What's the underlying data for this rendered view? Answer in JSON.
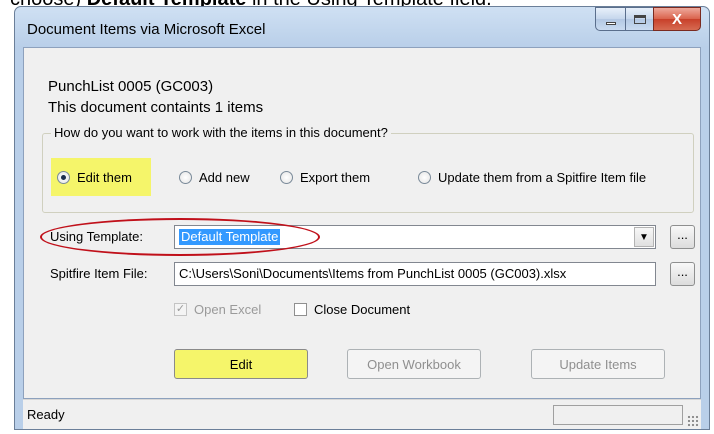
{
  "caption": {
    "prefix": "choose) ",
    "bold": "Default Template",
    "suffix": " in the Using Template field."
  },
  "window": {
    "title": "Document Items via Microsoft Excel",
    "close_glyph": "X"
  },
  "document": {
    "name": "PunchList 0005 (GC003)",
    "count_text": "This document containts 1 items"
  },
  "mode_group": {
    "legend": "How do you want to work with the items in this document?",
    "options": [
      {
        "label": "Edit them",
        "checked": true
      },
      {
        "label": "Add new",
        "checked": false
      },
      {
        "label": "Export them",
        "checked": false
      },
      {
        "label": "Update them from a Spitfire Item file",
        "checked": false
      }
    ]
  },
  "template": {
    "label": "Using Template:",
    "value": "Default Template",
    "browse_label": "..."
  },
  "item_file": {
    "label": "Spitfire Item File:",
    "value": "C:\\Users\\Soni\\Documents\\Items from PunchList 0005 (GC003).xlsx",
    "browse_label": "..."
  },
  "options": {
    "open_excel": {
      "label": "Open Excel",
      "checked": true,
      "enabled": false
    },
    "close_document": {
      "label": "Close Document",
      "checked": false,
      "enabled": true
    }
  },
  "buttons": {
    "edit": "Edit",
    "open_workbook": "Open Workbook",
    "update_items": "Update Items"
  },
  "status": {
    "text": "Ready"
  },
  "colors": {
    "highlight": "#f5f56a",
    "annotation_oval": "#c0101a",
    "selection": "#3399ff"
  }
}
